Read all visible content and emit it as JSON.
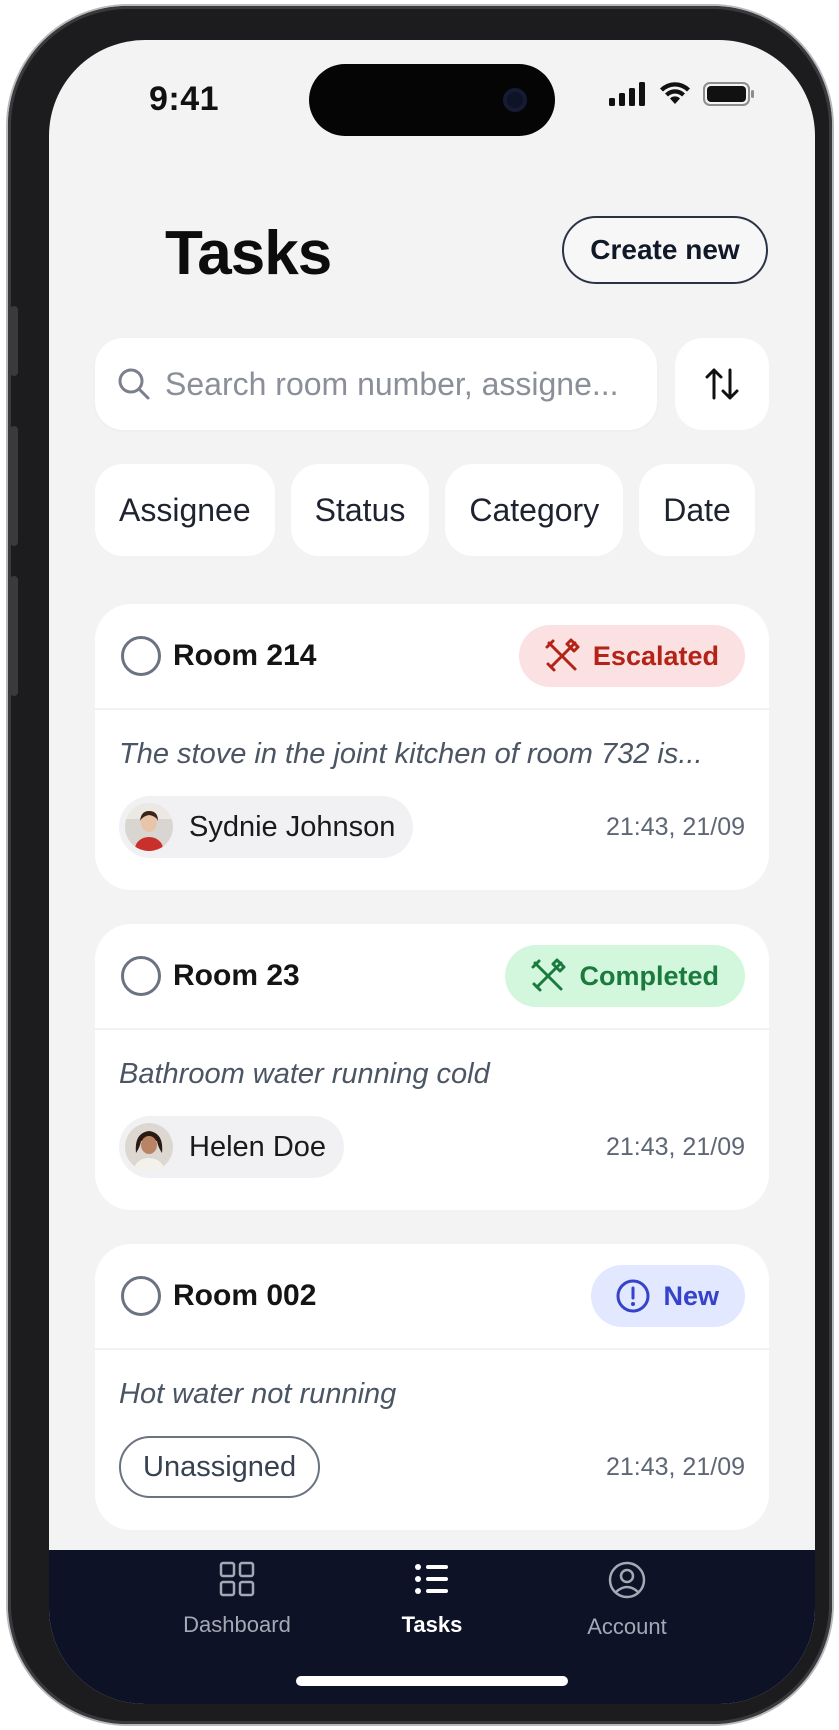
{
  "status_bar": {
    "time": "9:41"
  },
  "header": {
    "title": "Tasks",
    "create_label": "Create new"
  },
  "search": {
    "placeholder": "Search room number, assigne..."
  },
  "filters": [
    "Assignee",
    "Status",
    "Category",
    "Date"
  ],
  "tasks": [
    {
      "room": "Room 214",
      "status": "Escalated",
      "status_icon": "tools-icon",
      "status_colors": {
        "bg": "#fbe1e1",
        "fg": "#b42318"
      },
      "description": "The stove in the joint kitchen of room 732 is...",
      "assignee": "Sydnie Johnson",
      "timestamp": "21:43, 21/09"
    },
    {
      "room": "Room 23",
      "status": "Completed",
      "status_icon": "tools-icon",
      "status_colors": {
        "bg": "#d3f7dd",
        "fg": "#1b7a3d"
      },
      "description": "Bathroom water running cold",
      "assignee": "Helen Doe",
      "timestamp": "21:43, 21/09"
    },
    {
      "room": "Room 002",
      "status": "New",
      "status_icon": "exclamation-circle-icon",
      "status_colors": {
        "bg": "#e1e8ff",
        "fg": "#3542c9"
      },
      "description": "Hot water not running",
      "assignee": "Unassigned",
      "timestamp": "21:43, 21/09"
    }
  ],
  "tab_bar": {
    "tabs": [
      {
        "label": "Dashboard",
        "icon": "grid-icon"
      },
      {
        "label": "Tasks",
        "icon": "list-icon",
        "active": true
      },
      {
        "label": "Account",
        "icon": "user-circle-icon"
      }
    ]
  },
  "colors": {
    "accent_dark": "#0d1226",
    "background": "#f3f3f4"
  }
}
